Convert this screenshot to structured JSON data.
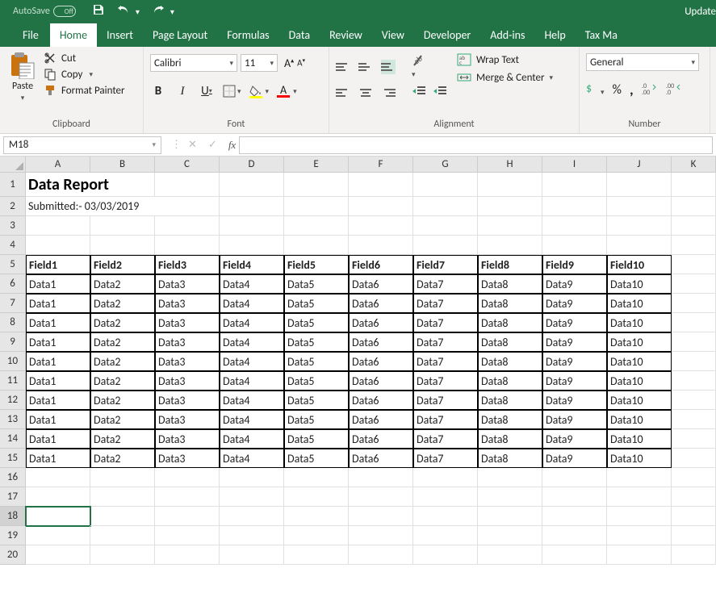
{
  "titlebar": {
    "autosave": "AutoSave",
    "toggle": "Off",
    "update": "Update"
  },
  "tabs": {
    "file": "File",
    "home": "Home",
    "insert": "Insert",
    "pagelayout": "Page Layout",
    "formulas": "Formulas",
    "data": "Data",
    "review": "Review",
    "view": "View",
    "developer": "Developer",
    "addins": "Add-ins",
    "help": "Help",
    "taxma": "Tax Ma"
  },
  "ribbon": {
    "clipboard": {
      "paste": "Paste",
      "cut": "Cut",
      "copy": "Copy",
      "format_painter": "Format Painter",
      "label": "Clipboard"
    },
    "font": {
      "name": "Calibri",
      "size": "11",
      "label": "Font"
    },
    "alignment": {
      "wrap": "Wrap Text",
      "merge": "Merge & Center",
      "label": "Alignment"
    },
    "number": {
      "format": "General",
      "label": "Number"
    }
  },
  "fbar": {
    "name": "M18",
    "fx": "fx"
  },
  "columns": [
    "A",
    "B",
    "C",
    "D",
    "E",
    "F",
    "G",
    "H",
    "I",
    "J",
    "K"
  ],
  "row_nums": [
    "1",
    "2",
    "3",
    "4",
    "5",
    "6",
    "7",
    "8",
    "9",
    "10",
    "11",
    "12",
    "13",
    "14",
    "15",
    "16",
    "17",
    "18",
    "19",
    "20"
  ],
  "sheet": {
    "title": "Data Report",
    "submitted": "Submitted:- 03/03/2019",
    "headers": [
      "Field1",
      "Field2",
      "Field3",
      "Field4",
      "Field5",
      "Field6",
      "Field7",
      "Field8",
      "Field9",
      "Field10"
    ],
    "row": [
      "Data1",
      "Data2",
      "Data3",
      "Data4",
      "Data5",
      "Data6",
      "Data7",
      "Data8",
      "Data9",
      "Data10"
    ]
  },
  "chart_data": {
    "type": "table",
    "title": "Data Report",
    "columns": [
      "Field1",
      "Field2",
      "Field3",
      "Field4",
      "Field5",
      "Field6",
      "Field7",
      "Field8",
      "Field9",
      "Field10"
    ],
    "rows": [
      [
        "Data1",
        "Data2",
        "Data3",
        "Data4",
        "Data5",
        "Data6",
        "Data7",
        "Data8",
        "Data9",
        "Data10"
      ],
      [
        "Data1",
        "Data2",
        "Data3",
        "Data4",
        "Data5",
        "Data6",
        "Data7",
        "Data8",
        "Data9",
        "Data10"
      ],
      [
        "Data1",
        "Data2",
        "Data3",
        "Data4",
        "Data5",
        "Data6",
        "Data7",
        "Data8",
        "Data9",
        "Data10"
      ],
      [
        "Data1",
        "Data2",
        "Data3",
        "Data4",
        "Data5",
        "Data6",
        "Data7",
        "Data8",
        "Data9",
        "Data10"
      ],
      [
        "Data1",
        "Data2",
        "Data3",
        "Data4",
        "Data5",
        "Data6",
        "Data7",
        "Data8",
        "Data9",
        "Data10"
      ],
      [
        "Data1",
        "Data2",
        "Data3",
        "Data4",
        "Data5",
        "Data6",
        "Data7",
        "Data8",
        "Data9",
        "Data10"
      ],
      [
        "Data1",
        "Data2",
        "Data3",
        "Data4",
        "Data5",
        "Data6",
        "Data7",
        "Data8",
        "Data9",
        "Data10"
      ],
      [
        "Data1",
        "Data2",
        "Data3",
        "Data4",
        "Data5",
        "Data6",
        "Data7",
        "Data8",
        "Data9",
        "Data10"
      ],
      [
        "Data1",
        "Data2",
        "Data3",
        "Data4",
        "Data5",
        "Data6",
        "Data7",
        "Data8",
        "Data9",
        "Data10"
      ],
      [
        "Data1",
        "Data2",
        "Data3",
        "Data4",
        "Data5",
        "Data6",
        "Data7",
        "Data8",
        "Data9",
        "Data10"
      ]
    ]
  }
}
